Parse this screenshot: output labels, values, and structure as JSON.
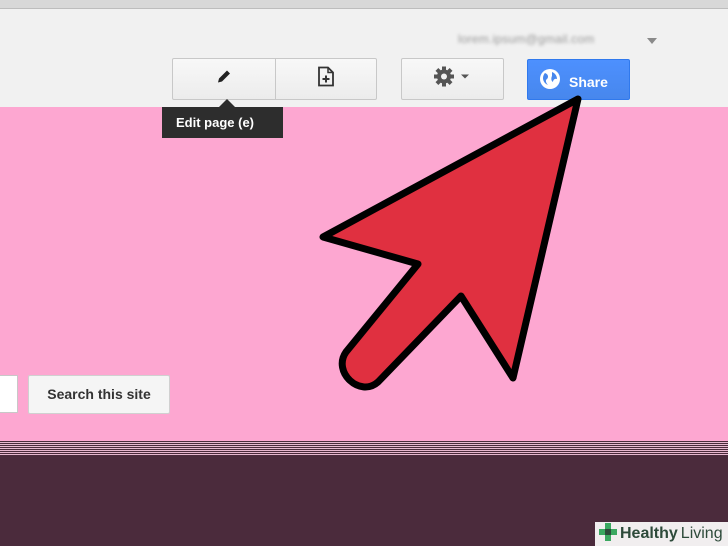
{
  "header": {
    "account_email": "lorem.ipsum@gmail.com"
  },
  "toolbar": {
    "edit_tooltip": "Edit page (e)",
    "share_label": "Share"
  },
  "search": {
    "button_label": "Search this site",
    "input_value": ""
  },
  "watermark": {
    "brand_bold": "Healthy",
    "brand_light": "Living"
  },
  "colors": {
    "page_background": "#fda7d1",
    "footer": "#4b2b3c",
    "share_blue": "#4d90fe",
    "arrow_red": "#e03040"
  },
  "icons": {
    "edit": "pencil-icon",
    "new_page": "new-page-icon",
    "settings": "gear-icon",
    "share": "globe-icon"
  }
}
